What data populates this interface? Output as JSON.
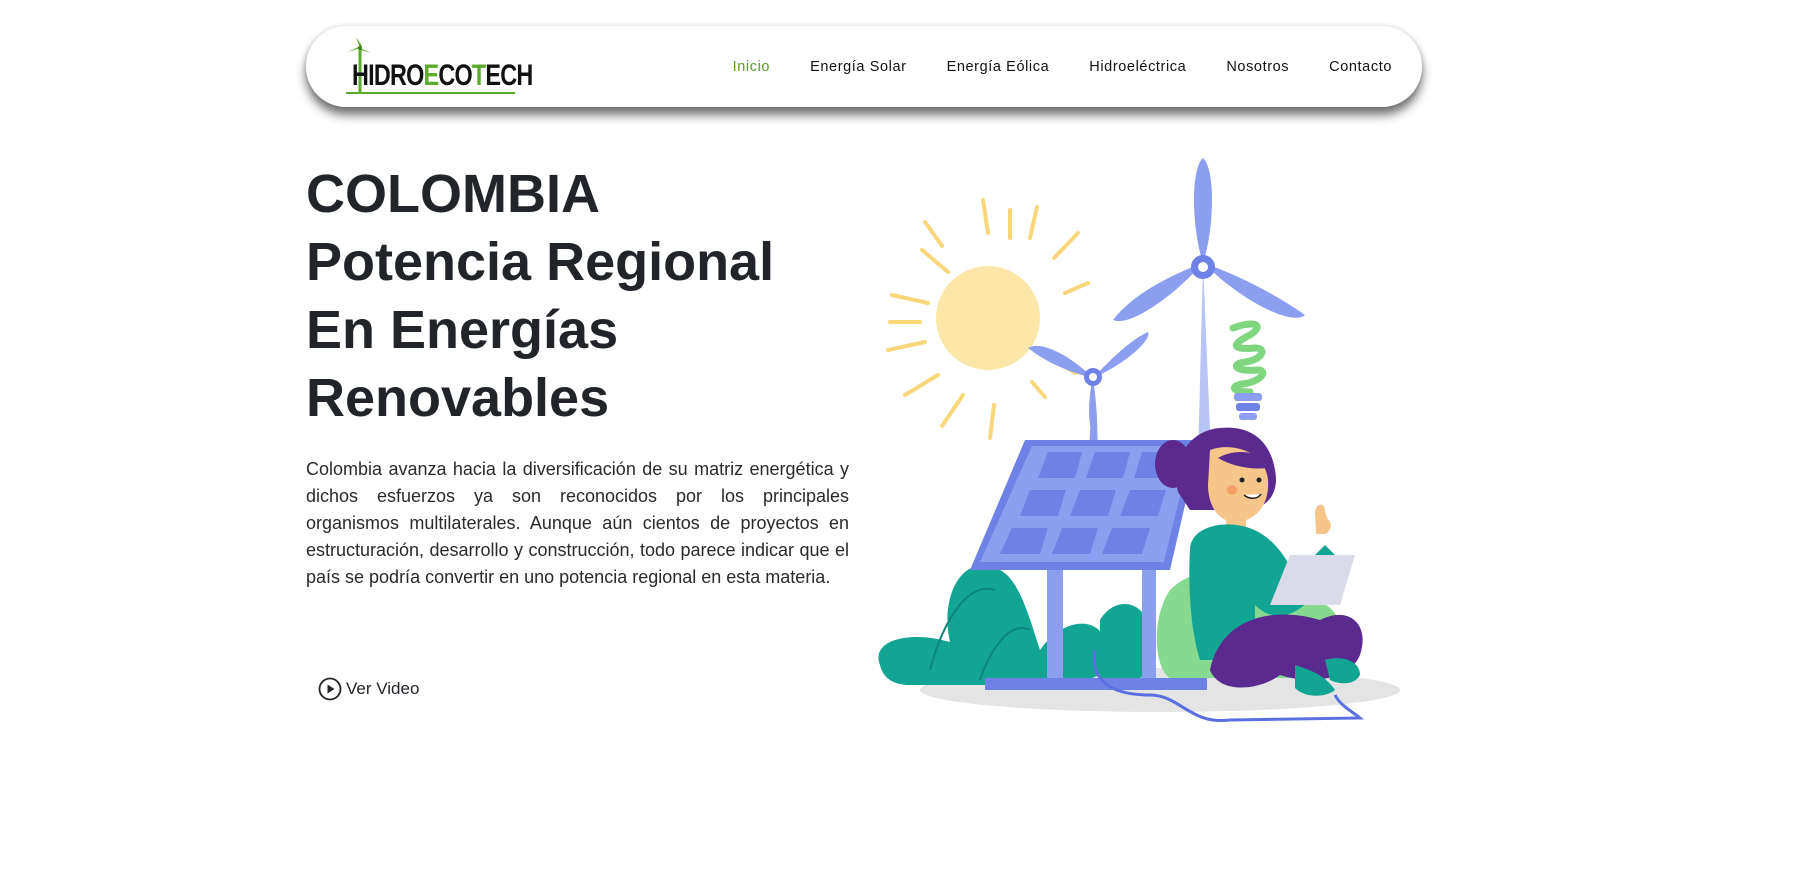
{
  "brand": {
    "logo_text_prefix": "H",
    "logo_text_mid": "IDRO",
    "logo_e": "E",
    "logo_co": "CO",
    "logo_t": "T",
    "logo_ech": "ECH"
  },
  "nav": {
    "items": [
      {
        "label": "Inicio",
        "active": true
      },
      {
        "label": "Energía Solar",
        "active": false
      },
      {
        "label": "Energía Eólica",
        "active": false
      },
      {
        "label": "Hidroeléctrica",
        "active": false
      },
      {
        "label": "Nosotros",
        "active": false
      },
      {
        "label": "Contacto",
        "active": false
      }
    ]
  },
  "hero": {
    "title_lines": [
      "COLOMBIA",
      "Potencia Regional",
      "En Energías",
      "Renovables"
    ],
    "paragraph": "Colombia avanza hacia la diversificación de su matriz energética y dichos esfuerzos ya son reconocidos por los principales organismos multilaterales. Aunque aún cientos de proyectos en estructuración, desarrollo y construcción, todo parece indicar que el país se podría convertir en uno potencia regional en esta materia.",
    "video_button": "Ver Video"
  },
  "colors": {
    "accent_green": "#5cab2b",
    "text_dark": "#212529",
    "illustration_blue": "#8c9ef0",
    "teal": "#12a594",
    "sun": "#fde7a8",
    "purple": "#5b2a8f"
  }
}
